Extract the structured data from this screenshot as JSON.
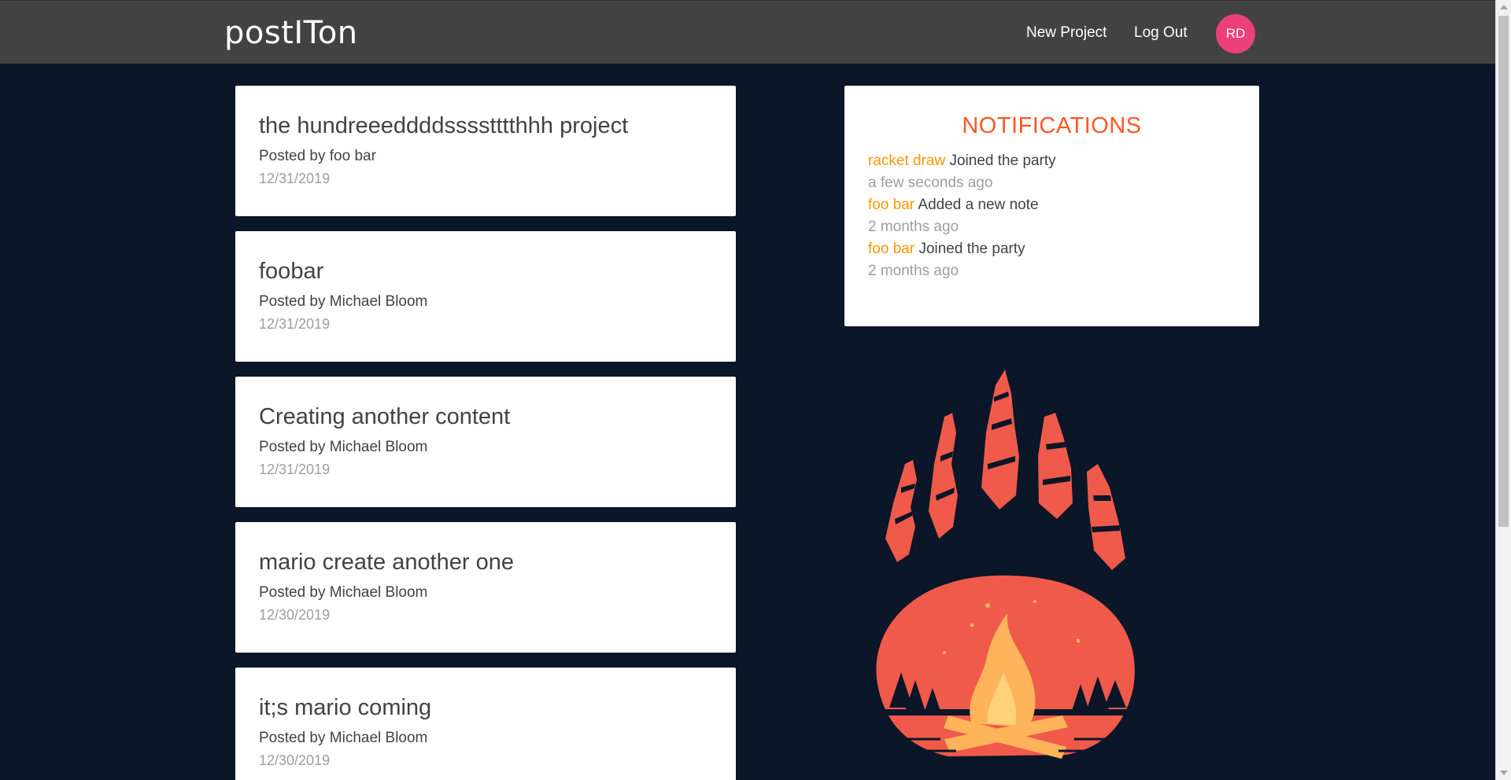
{
  "navbar": {
    "brand": "postITon",
    "new_project_label": "New Project",
    "logout_label": "Log Out",
    "avatar_initials": "RD",
    "avatar_color": "#ec407a"
  },
  "projects": [
    {
      "title": "the hundreeeddddsssstttthhh project",
      "author": "Posted by foo bar",
      "date": "12/31/2019"
    },
    {
      "title": "foobar",
      "author": "Posted by Michael Bloom",
      "date": "12/31/2019"
    },
    {
      "title": "Creating another content",
      "author": "Posted by Michael Bloom",
      "date": "12/31/2019"
    },
    {
      "title": "mario create another one",
      "author": "Posted by Michael Bloom",
      "date": "12/30/2019"
    },
    {
      "title": "it;s mario coming",
      "author": "Posted by Michael Bloom",
      "date": "12/30/2019"
    }
  ],
  "notifications": {
    "title": "NOTIFICATIONS",
    "items": [
      {
        "user": "racket draw",
        "action": "Joined the party",
        "time": "a few seconds ago"
      },
      {
        "user": "foo bar",
        "action": "Added a new note",
        "time": "2 months ago"
      },
      {
        "user": "foo bar",
        "action": "Joined the party",
        "time": "2 months ago"
      }
    ]
  },
  "colors": {
    "background": "#0b1628",
    "navbar": "#424242",
    "notification_title": "#ff5722",
    "notification_user": "#ff9800",
    "illustration_main": "#ef5a4a",
    "illustration_flame": "#ffb35a"
  },
  "illustration": {
    "icon": "bear-paw-campfire-icon"
  }
}
